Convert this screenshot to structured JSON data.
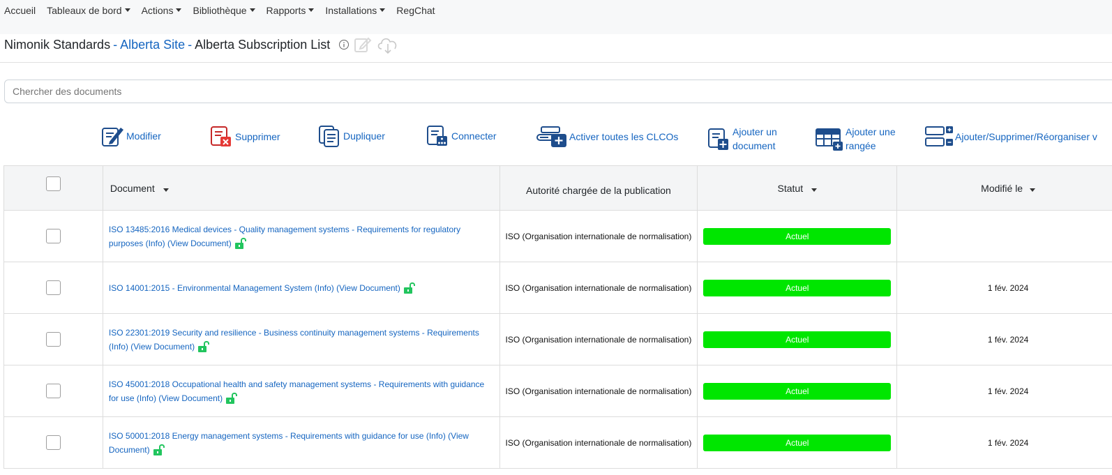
{
  "nav": {
    "items": [
      {
        "label": "Accueil",
        "dropdown": false
      },
      {
        "label": "Tableaux de bord",
        "dropdown": true
      },
      {
        "label": "Actions",
        "dropdown": true
      },
      {
        "label": "Bibliothèque",
        "dropdown": true
      },
      {
        "label": "Rapports",
        "dropdown": true
      },
      {
        "label": "Installations",
        "dropdown": true
      },
      {
        "label": "RegChat",
        "dropdown": false
      }
    ]
  },
  "title": {
    "org": "Nimonik Standards",
    "sep1": "-",
    "site": "Alberta Site",
    "sep2": "-",
    "list": "Alberta Subscription List",
    "icons": [
      "info-icon",
      "edit-icon",
      "cloud-download-icon"
    ]
  },
  "search": {
    "placeholder": "Chercher des documents",
    "value": ""
  },
  "toolbar": {
    "modify": "Modifier",
    "delete": "Supprimer",
    "duplicate": "Dupliquer",
    "connect": "Connecter",
    "activate": "Activer toutes les CLCOs",
    "add_doc_1": "Ajouter un",
    "add_doc_2": "document",
    "add_row_1": "Ajouter une",
    "add_row_2": "rangée",
    "reorg": "Ajouter/Supprimer/Réorganiser v"
  },
  "table": {
    "headers": {
      "document": "Document",
      "authority": "Autorité chargée de la publication",
      "status": "Statut",
      "modified": "Modifié le"
    },
    "rows": [
      {
        "doc_l1": "ISO 13485:2016 Medical devices - Quality management systems - Requirements for regulatory",
        "doc_l2": "purposes (Info) (View Document)",
        "authority": "ISO (Organisation internationale de normalisation)",
        "status": "Actuel",
        "modified": ""
      },
      {
        "doc_l1": "ISO 14001:2015 - Environmental Management System (Info) (View Document)",
        "doc_l2": "",
        "authority": "ISO (Organisation internationale de normalisation)",
        "status": "Actuel",
        "modified": "1 fév. 2024"
      },
      {
        "doc_l1": "ISO 22301:2019 Security and resilience - Business continuity management systems - Requirements",
        "doc_l2": "(Info) (View Document)",
        "authority": "ISO (Organisation internationale de normalisation)",
        "status": "Actuel",
        "modified": "1 fév. 2024"
      },
      {
        "doc_l1": "ISO 45001:2018 Occupational health and safety management systems - Requirements with guidance",
        "doc_l2": "for use (Info) (View Document)",
        "authority": "ISO (Organisation internationale de normalisation)",
        "status": "Actuel",
        "modified": "1 fév. 2024"
      },
      {
        "doc_l1": "ISO 50001:2018 Energy management systems - Requirements with guidance for use (Info) (View",
        "doc_l2": "Document)",
        "authority": "ISO (Organisation internationale de normalisation)",
        "status": "Actuel",
        "modified": "1 fév. 2024"
      }
    ]
  },
  "colors": {
    "link": "#1565c0",
    "status_active": "#00e600",
    "unlock_icon": "#22c55e"
  }
}
